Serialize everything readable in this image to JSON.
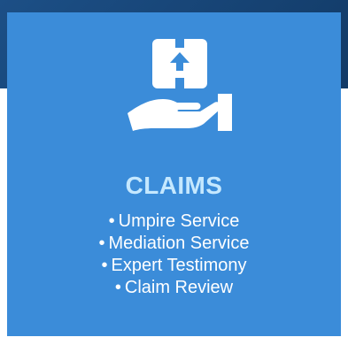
{
  "card": {
    "icon": "hand-holding-package-icon",
    "title": "CLAIMS",
    "services": [
      "Umpire Service",
      "Mediation Service",
      "Expert Testimony",
      "Claim Review"
    ]
  },
  "colors": {
    "background_top": "#1c4f86",
    "card_bg": "#3b8cd9",
    "title": "#c5e8ff",
    "text": "#ffffff"
  }
}
